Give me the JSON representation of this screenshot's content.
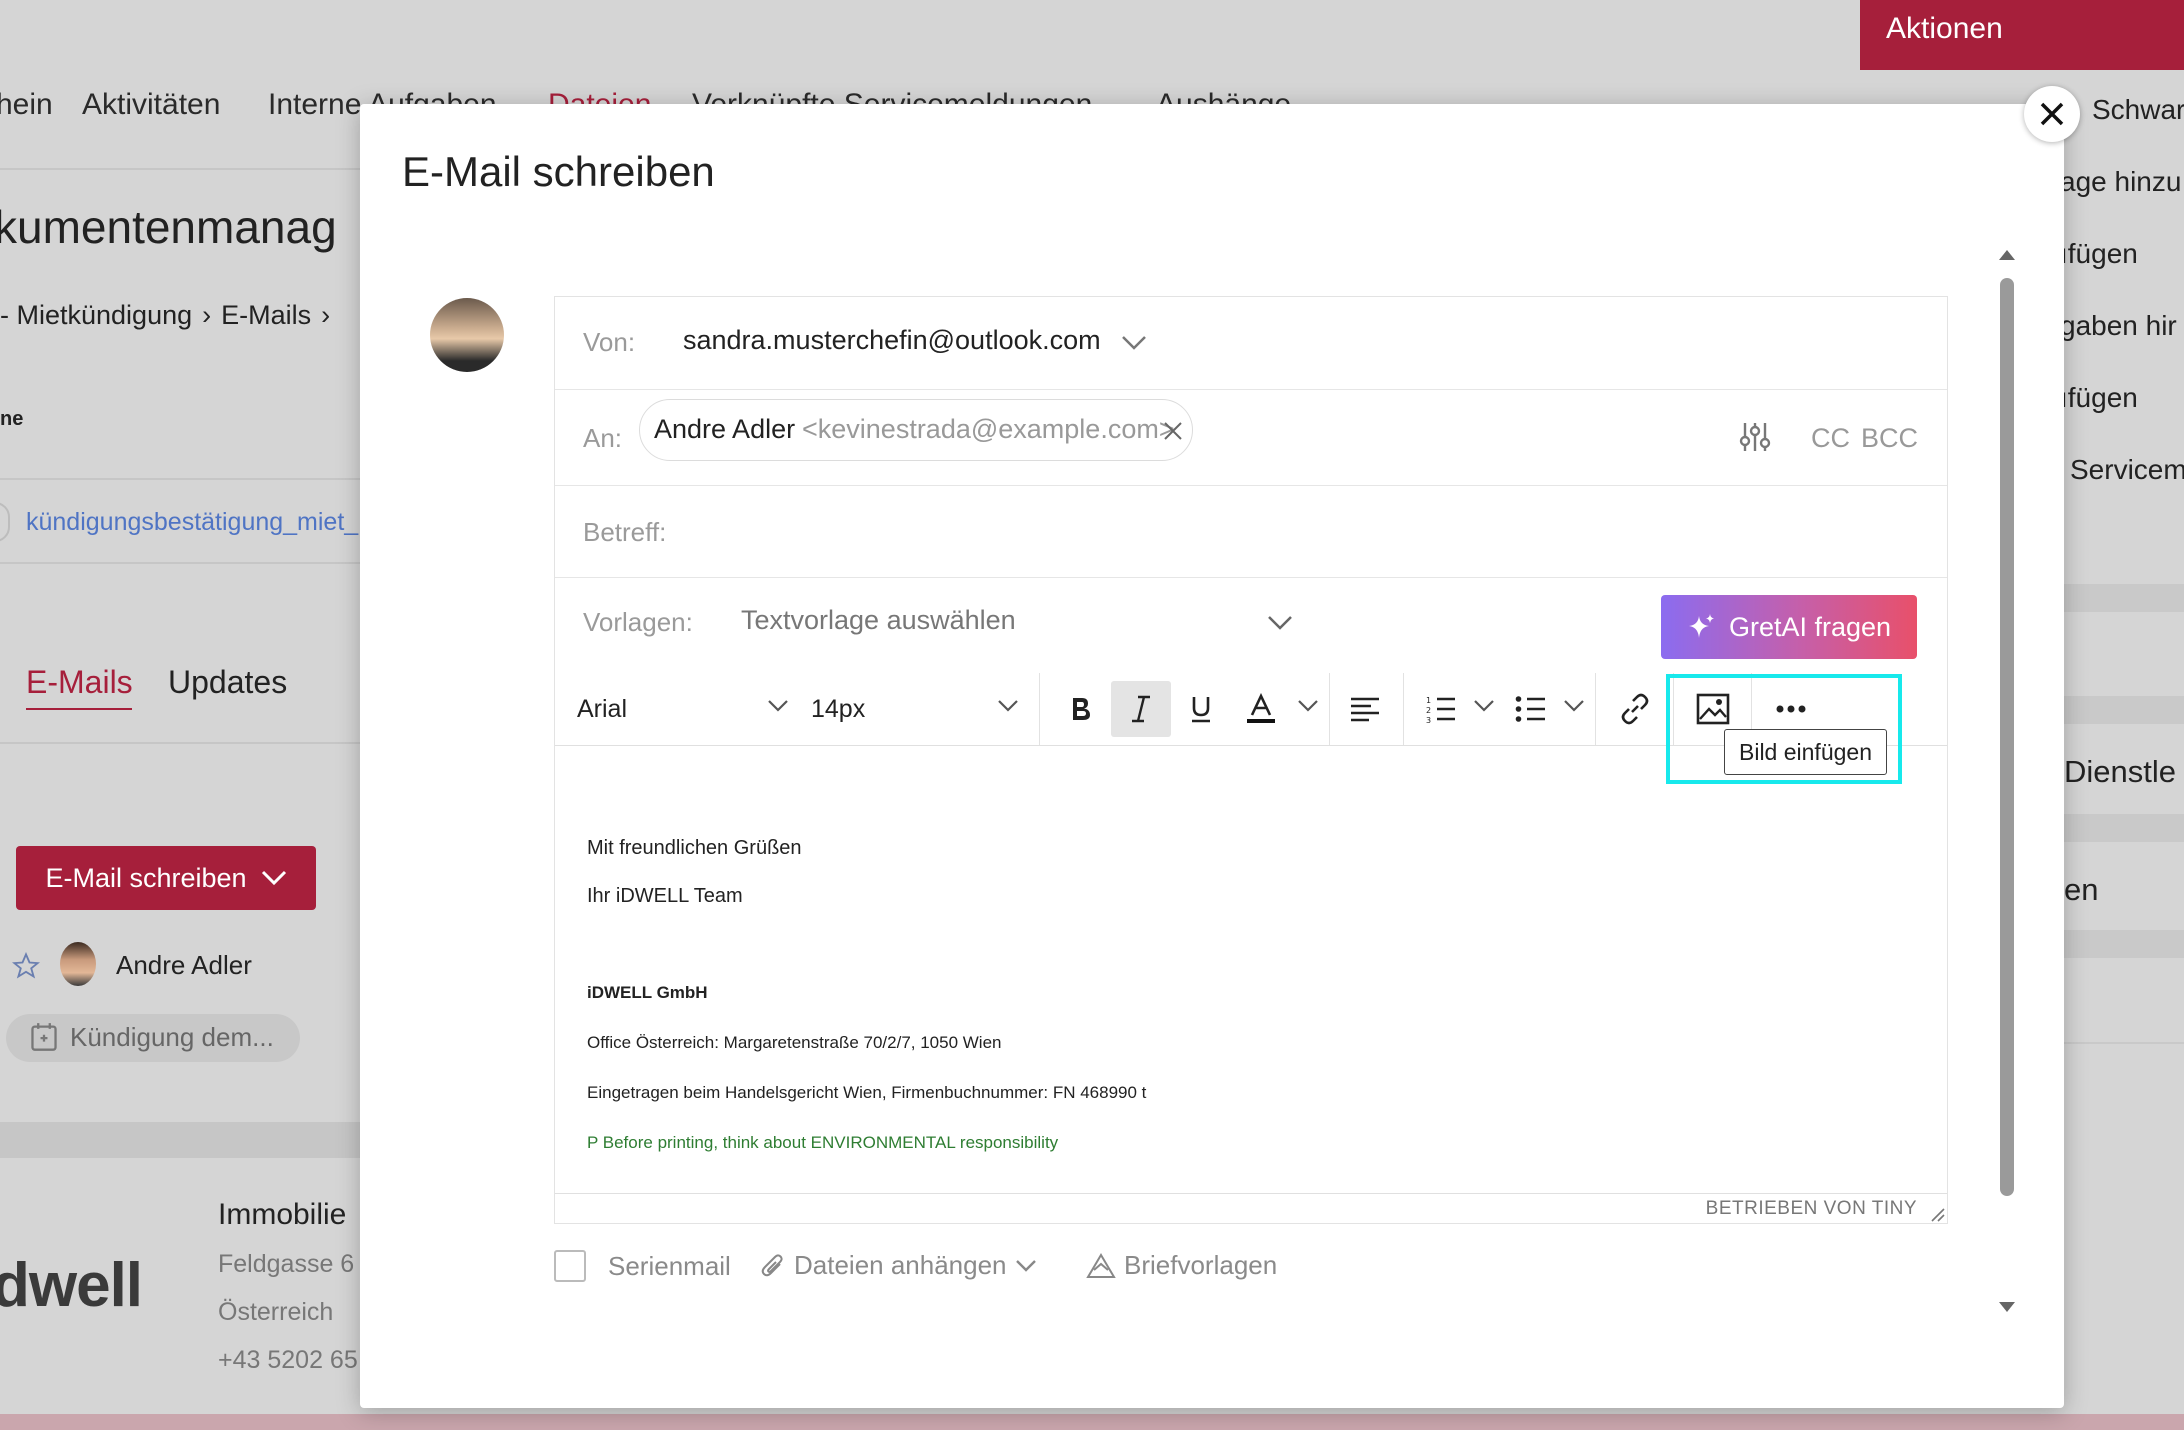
{
  "background": {
    "nav_tabs": [
      "hein",
      "Aktivitäten",
      "Interne Aufgaben",
      "Dateien",
      "Verknüpfte Servicemeldungen",
      "Aushänge"
    ],
    "section_title": "kumentenmanag",
    "breadcrumb": [
      "- Mietkündigung",
      "E-Mails"
    ],
    "column_label": "ne",
    "file_link": "kündigungsbestätigung_miet_",
    "tabs": [
      "E-Mails",
      "Updates"
    ],
    "compose_button": "E-Mail schreiben",
    "contact_name": "Andre Adler",
    "tag_label": "Kündigung dem...",
    "company_title": "Immobilie",
    "address_lines": [
      "Feldgasse 6",
      "Österreich",
      "+43 5202 65"
    ],
    "logo_text": "dwell",
    "accent_color": "#a61f3b"
  },
  "right_panel": {
    "title": "Aktionen",
    "items": [
      "Schwar",
      "age hinzu",
      "ıfügen",
      "gaben hir",
      "ıfügen",
      "Servicem",
      "Dienstle",
      "en"
    ]
  },
  "modal": {
    "title": "E-Mail schreiben",
    "from": {
      "label": "Von:",
      "value": "sandra.musterchefin@outlook.com"
    },
    "to": {
      "label": "An:",
      "name": "Andre Adler",
      "email": "<kevinestrada@example.com>"
    },
    "cc": "CC",
    "bcc": "BCC",
    "subject": {
      "label": "Betreff:",
      "value": ""
    },
    "templates": {
      "label": "Vorlagen:",
      "placeholder": "Textvorlage auswählen"
    },
    "ai_button": "GretAI fragen",
    "toolbar": {
      "font": "Arial",
      "size": "14px",
      "tooltip": "Bild einfügen"
    },
    "body": {
      "greeting": "Mit freundlichen Grüßen",
      "team": "Ihr iDWELL Team",
      "company": "iDWELL GmbH",
      "office": "Office Österreich: Margaretenstraße 70/2/7, 1050 Wien",
      "register": "Eingetragen beim Handelsgericht Wien, Firmenbuchnummer: FN 468990 t",
      "eco": "P Before printing, think about ENVIRONMENTAL responsibility"
    },
    "powered_by": "BETRIEBEN VON TINY",
    "footer": {
      "serial": "Serienmail",
      "attach": "Dateien anhängen",
      "letters": "Briefvorlagen"
    }
  }
}
